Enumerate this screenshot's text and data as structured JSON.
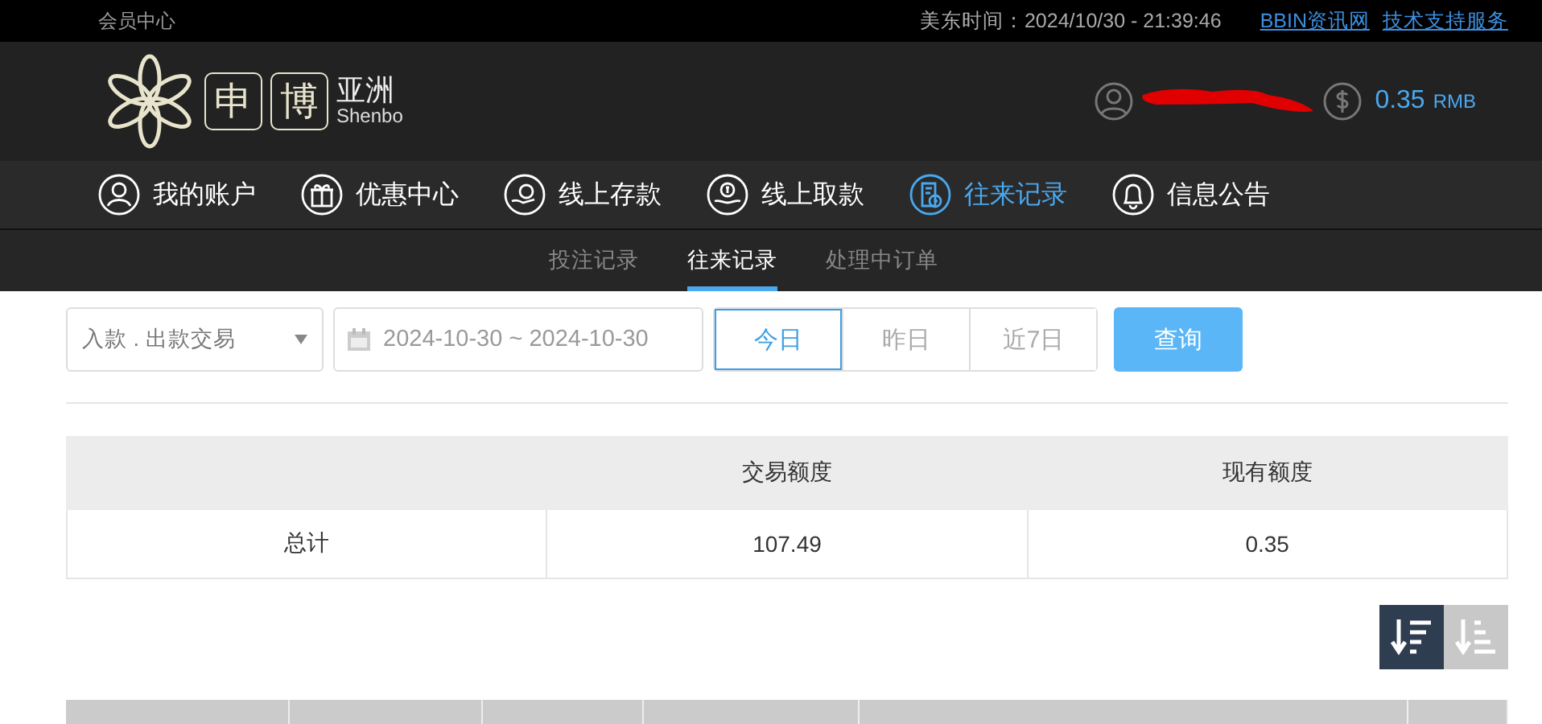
{
  "top_bar": {
    "title": "会员中心",
    "clock_label": "美东时间：",
    "clock": "2024/10/30 - 21:39:46",
    "links": [
      "BBIN资讯网",
      "技术支持服务"
    ]
  },
  "header": {
    "logo": {
      "chars": [
        "申",
        "博"
      ],
      "name": "亚洲",
      "latin": "Shenbo"
    },
    "balance": "0.35",
    "currency": "RMB"
  },
  "nav": [
    {
      "label": "我的账户",
      "kind": "user",
      "selected": false
    },
    {
      "label": "优惠中心",
      "kind": "gift",
      "selected": false
    },
    {
      "label": "线上存款",
      "kind": "deposit",
      "selected": false
    },
    {
      "label": "线上取款",
      "kind": "withdraw",
      "selected": false
    },
    {
      "label": "往来记录",
      "kind": "record",
      "selected": true
    },
    {
      "label": "信息公告",
      "kind": "bell",
      "selected": false
    }
  ],
  "sub_tabs": [
    {
      "label": "投注记录",
      "selected": false
    },
    {
      "label": "往来记录",
      "selected": true
    },
    {
      "label": "处理中订单",
      "selected": false
    }
  ],
  "filter": {
    "type_select": "入款 . 出款交易",
    "date_range": "2024-10-30 ~ 2024-10-30",
    "quick_ranges": [
      {
        "label": "今日",
        "selected": true
      },
      {
        "label": "昨日",
        "selected": false
      },
      {
        "label": "近7日",
        "selected": false
      }
    ],
    "search_button": "查询"
  },
  "summary": {
    "columns": [
      "",
      "交易额度",
      "现有额度"
    ],
    "rows": [
      [
        "总计",
        "107.49",
        "0.35"
      ]
    ]
  },
  "sort_buttons": [
    {
      "kind": "descending",
      "selected": true
    },
    {
      "kind": "ascending",
      "selected": false
    }
  ]
}
